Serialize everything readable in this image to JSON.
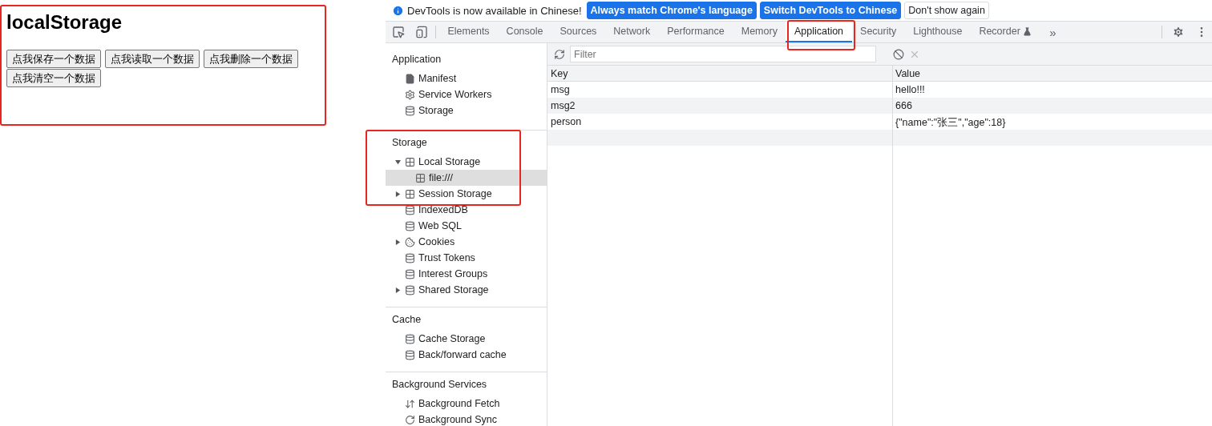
{
  "page": {
    "heading": "localStorage",
    "buttons": [
      "点我保存一个数据",
      "点我读取一个数据",
      "点我删除一个数据",
      "点我清空一个数据"
    ]
  },
  "infobar": {
    "message": "DevTools is now available in Chinese!",
    "buttons": [
      {
        "label": "Always match Chrome's language",
        "kind": "primary"
      },
      {
        "label": "Switch DevTools to Chinese",
        "kind": "primary"
      },
      {
        "label": "Don't show again",
        "kind": "plain"
      }
    ]
  },
  "tabs": [
    {
      "label": "Elements",
      "selected": false
    },
    {
      "label": "Console",
      "selected": false
    },
    {
      "label": "Sources",
      "selected": false
    },
    {
      "label": "Network",
      "selected": false
    },
    {
      "label": "Performance",
      "selected": false
    },
    {
      "label": "Memory",
      "selected": false
    },
    {
      "label": "Application",
      "selected": true
    },
    {
      "label": "Security",
      "selected": false
    },
    {
      "label": "Lighthouse",
      "selected": false
    },
    {
      "label": "Recorder",
      "selected": false
    }
  ],
  "tabs_overflow": "»",
  "sidebar": {
    "sections": [
      {
        "title": "Application",
        "items": [
          {
            "label": "Manifest",
            "kind": "file",
            "selected": false
          },
          {
            "label": "Service Workers",
            "kind": "gear",
            "selected": false
          },
          {
            "label": "Storage",
            "kind": "database",
            "selected": false
          }
        ]
      },
      {
        "title": "Storage",
        "items": [
          {
            "label": "Local Storage",
            "kind": "grid",
            "selected": false,
            "expanded": true,
            "children": [
              {
                "label": "file:///",
                "kind": "grid",
                "selected": true
              }
            ]
          },
          {
            "label": "Session Storage",
            "kind": "grid",
            "selected": false,
            "expanded": false
          },
          {
            "label": "IndexedDB",
            "kind": "database",
            "selected": false
          },
          {
            "label": "Web SQL",
            "kind": "database",
            "selected": false
          },
          {
            "label": "Cookies",
            "kind": "cookie",
            "selected": false,
            "expanded": false
          },
          {
            "label": "Trust Tokens",
            "kind": "database",
            "selected": false
          },
          {
            "label": "Interest Groups",
            "kind": "database",
            "selected": false
          },
          {
            "label": "Shared Storage",
            "kind": "database",
            "selected": false,
            "expanded": false
          }
        ]
      },
      {
        "title": "Cache",
        "items": [
          {
            "label": "Cache Storage",
            "kind": "database",
            "selected": false
          },
          {
            "label": "Back/forward cache",
            "kind": "database",
            "selected": false
          }
        ]
      },
      {
        "title": "Background Services",
        "items": [
          {
            "label": "Background Fetch",
            "kind": "arrows",
            "selected": false
          },
          {
            "label": "Background Sync",
            "kind": "sync",
            "selected": false
          }
        ]
      }
    ]
  },
  "storage_table": {
    "filter": {
      "placeholder": "Filter"
    },
    "columns": [
      "Key",
      "Value"
    ],
    "rows": [
      [
        "msg",
        "hello!!!"
      ],
      [
        "msg2",
        "666"
      ],
      [
        "person",
        "{\"name\":\"张三\",\"age\":18}"
      ]
    ]
  }
}
